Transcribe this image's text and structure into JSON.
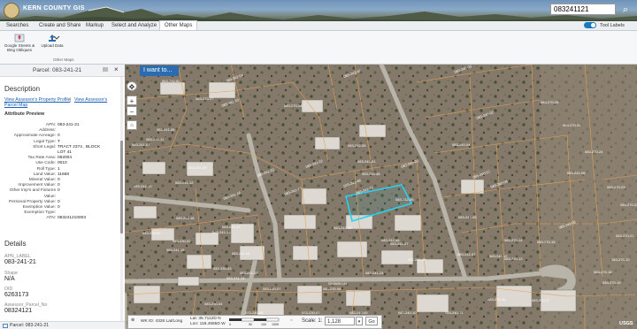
{
  "header": {
    "app_title": "KERN COUNTY GIS",
    "search_value": "083241121"
  },
  "tabs": [
    {
      "label": "Searches"
    },
    {
      "label": "Create and Share"
    },
    {
      "label": "Markup"
    },
    {
      "label": "Select and Analyze"
    },
    {
      "label": "Other Maps",
      "active": true
    }
  ],
  "tool_labels": {
    "label": "Tool Labels",
    "on": true
  },
  "ribbon": {
    "items": [
      {
        "label": "Google Streets &\nBing Obliques",
        "icon": "google-map-icon"
      },
      {
        "label": "Upload Data",
        "icon": "upload-icon"
      }
    ],
    "group_name": "Other Maps"
  },
  "panel": {
    "title": "Parcel: 083-241-21",
    "description_heading": "Description",
    "links": [
      "View Assessor's Property Profile",
      "|",
      "View Assessor's",
      "Parcel Map"
    ],
    "attribute_preview_heading": "Attribute Preview",
    "attributes": [
      {
        "label": "APN:",
        "value": "083-241-21"
      },
      {
        "label": "Address:",
        "value": ""
      },
      {
        "label": "Approximate Acreage:",
        "value": "0"
      },
      {
        "label": "Legal Type:",
        "value": "T"
      },
      {
        "label": "Short Legal:",
        "value": "TRACT 2374 , BLOCK"
      },
      {
        "label": "",
        "value": "LOT 41"
      },
      {
        "label": "Tax Rate Area:",
        "value": "062004"
      },
      {
        "label": "Use Code:",
        "value": "0010"
      },
      {
        "label": "Roll Type:",
        "value": "1"
      },
      {
        "label": "Land Value:",
        "value": "11668"
      },
      {
        "label": "Mineral Value:",
        "value": "0"
      },
      {
        "label": "Improvement Value:",
        "value": "0"
      },
      {
        "label": "Other Imp's and Fixtures",
        "value": "0"
      },
      {
        "label": "Value:",
        "value": ""
      },
      {
        "label": "Personal Property Value:",
        "value": "0"
      },
      {
        "label": "Exemption Value:",
        "value": "0"
      },
      {
        "label": "Exemption Type:",
        "value": ""
      },
      {
        "label": "ATN:",
        "value": "083241210003"
      }
    ],
    "details_heading": "Details",
    "details": [
      {
        "label": "APN_LABEL",
        "value": "083-241-21"
      },
      {
        "label": "Shape",
        "value": "N/A"
      },
      {
        "label": "OID",
        "value": "6263173"
      },
      {
        "label": "Assessor_Parcel_No",
        "value": "08324121"
      }
    ],
    "footer_label": "Parcel: 083-241-21"
  },
  "map": {
    "i_want_to": "I want to...",
    "parcel_labels": [
      "083-241-21",
      "083-241-20",
      "083-241-22",
      "083-241-19",
      "083-241-23",
      "083-241-18",
      "083-242-45",
      "083-242-46",
      "083-242-47",
      "083-241-24",
      "083-241-17",
      "083-241-04",
      "083-241-03",
      "083-242-48",
      "083-242-49",
      "083-240-02",
      "083-240-03",
      "083-240-04",
      "083-240-05",
      "083-242-51",
      "083-241-25",
      "083-241-16",
      "083-242-52",
      "083-242-53",
      "083-242-54",
      "083-242-55",
      "083-242-56",
      "083-241-26",
      "083-242-57",
      "083-240-06",
      "083-241-15",
      "083-241-27",
      "083-241-08",
      "083-241-09",
      "083-241-10",
      "083-241-11",
      "083-241-12",
      "083-241-13",
      "083-241-14",
      "083-241-07",
      "083-241-06",
      "083-241-05",
      "083-230-01",
      "083-230-02",
      "083-230-03",
      "083-230-04",
      "083-230-05",
      "083-230-06",
      "083-240-07",
      "083-240-08",
      "083-240-09",
      "083-240-10",
      "083-240-11",
      "083-240-12",
      "083-270-13",
      "083-270-14",
      "083-270-15",
      "083-270-16",
      "083-270-17",
      "083-270-18",
      "083-270-19",
      "083-270-20",
      "083-270-21",
      "083-270-22",
      "083-270-23",
      "083-270-24",
      "083-270-25",
      "083-270-26",
      "083-270-27",
      "083-270-28"
    ],
    "street_label": "SHAWN LN",
    "status": {
      "wkid": "WK ID: 4326 Lat/Long",
      "lat": "Lat: 35.7112D N",
      "lon": "Lon: 118.4565D W",
      "scale_label": "Scale: 1:",
      "scale_value": "1,128",
      "go": "Go",
      "scale_ticks": [
        "0",
        "50",
        "100",
        "150ft"
      ]
    },
    "attribution": "USGS"
  }
}
